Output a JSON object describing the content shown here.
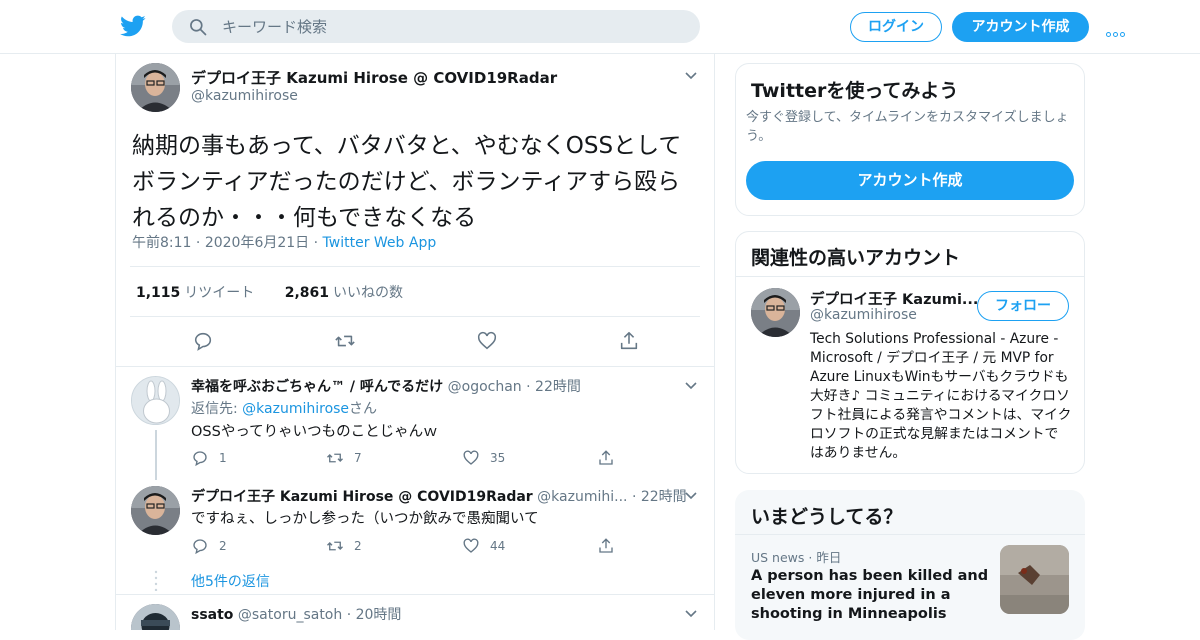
{
  "header": {
    "search_placeholder": "キーワード検索",
    "login_label": "ログイン",
    "signup_label": "アカウント作成",
    "brand_color": "#1da1f2"
  },
  "tweet": {
    "author_name": "デプロイ王子 Kazumi Hirose @ COVID19Radar",
    "author_handle": "@kazumihirose",
    "text": "納期の事もあって、バタバタと、やむなくOSSとしてボランティアだったのだけど、ボランティアすら殴られるのか・・・何もできなくなる",
    "time": "午前8:11",
    "date": "2020年6月21日",
    "source": "Twitter Web App",
    "retweets": "1,115",
    "retweets_label": "リツイート",
    "likes": "2,861",
    "likes_label": "いいねの数"
  },
  "replies": [
    {
      "name": "幸福を呼ぶおごちゃん™ / 呼んでるだけ",
      "handle": "@ogochan",
      "time": "22時間",
      "reply_to_prefix": "返信先: ",
      "reply_to": "@kazumihirose",
      "reply_to_suffix": "さん",
      "text": "OSSやってりゃいつものことじゃんｗ",
      "replies": "1",
      "retweets": "7",
      "likes": "35"
    },
    {
      "name": "デプロイ王子 Kazumi Hirose @ COVID19Radar",
      "handle": "@kazumihi...",
      "time": "22時間",
      "text": "ですねぇ、しっかし参った（いつか飲みで愚痴聞いて",
      "replies": "2",
      "retweets": "2",
      "likes": "44",
      "more_replies": "他5件の返信"
    },
    {
      "name": "ssato",
      "handle": "@satoru_satoh",
      "time": "20時間"
    }
  ],
  "sidebar": {
    "try_title": "Twitterを使ってみよう",
    "try_desc": "今すぐ登録して、タイムラインをカスタマイズしましょう。",
    "try_button": "アカウント作成",
    "related_title": "関連性の高いアカウント",
    "related_name": "デプロイ王子 Kazumi...",
    "related_handle": "@kazumihirose",
    "follow_label": "フォロー",
    "related_bio": "Tech Solutions Professional - Azure - Microsoft / デプロイ王子 / 元 MVP for Azure LinuxもWinもサーバもクラウドも大好き♪ コミュニティにおけるマイクロソフト社員による発言やコメントは、マイクロソフトの正式な見解またはコメントではありません。",
    "trends_title": "いまどうしてる？",
    "trend_category": "US news",
    "trend_time": "昨日",
    "trend_text": "A person has been killed and eleven more injured in a shooting in Minneapolis"
  }
}
